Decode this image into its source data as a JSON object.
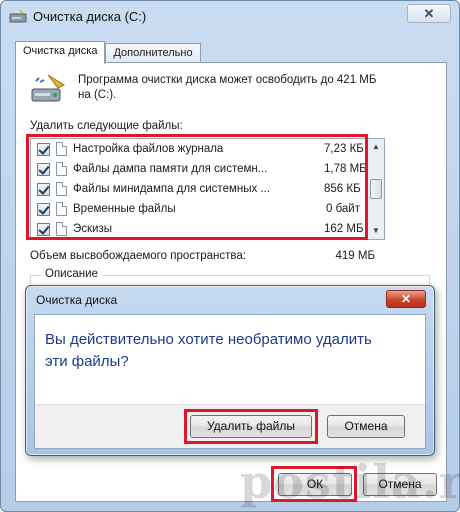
{
  "window": {
    "title": "Очистка диска  (C:)",
    "close_label": "✕"
  },
  "tabs": [
    {
      "label": "Очистка диска",
      "active": true
    },
    {
      "label": "Дополнительно",
      "active": false
    }
  ],
  "description": "Программа очистки диска может освободить до 421 МБ на  (C:).",
  "delete_label": "Удалить следующие файлы:",
  "files": [
    {
      "name": "Настройка файлов журнала",
      "size": "7,23 КБ",
      "checked": true
    },
    {
      "name": "Файлы дампа памяти для системн...",
      "size": "1,78 МБ",
      "checked": true
    },
    {
      "name": "Файлы минидампа для системных ...",
      "size": "856 КБ",
      "checked": true
    },
    {
      "name": "Временные файлы",
      "size": "0 байт",
      "checked": true
    },
    {
      "name": "Эскизы",
      "size": "162 МБ",
      "checked": true
    }
  ],
  "space": {
    "label": "Объем высвобождаемого пространства:",
    "value": "419 МБ"
  },
  "group_label": "Описание",
  "main_buttons": {
    "ok": "ОК",
    "cancel": "Отмена"
  },
  "dialog": {
    "title": "Очистка диска",
    "close_label": "✕",
    "message": "Вы действительно хотите необратимо удалить эти файлы?",
    "delete_button": "Удалить файлы",
    "cancel_button": "Отмена"
  },
  "watermark": "postila.ru",
  "colors": {
    "highlight": "#e0162b",
    "message_text": "#1e3a8a"
  }
}
